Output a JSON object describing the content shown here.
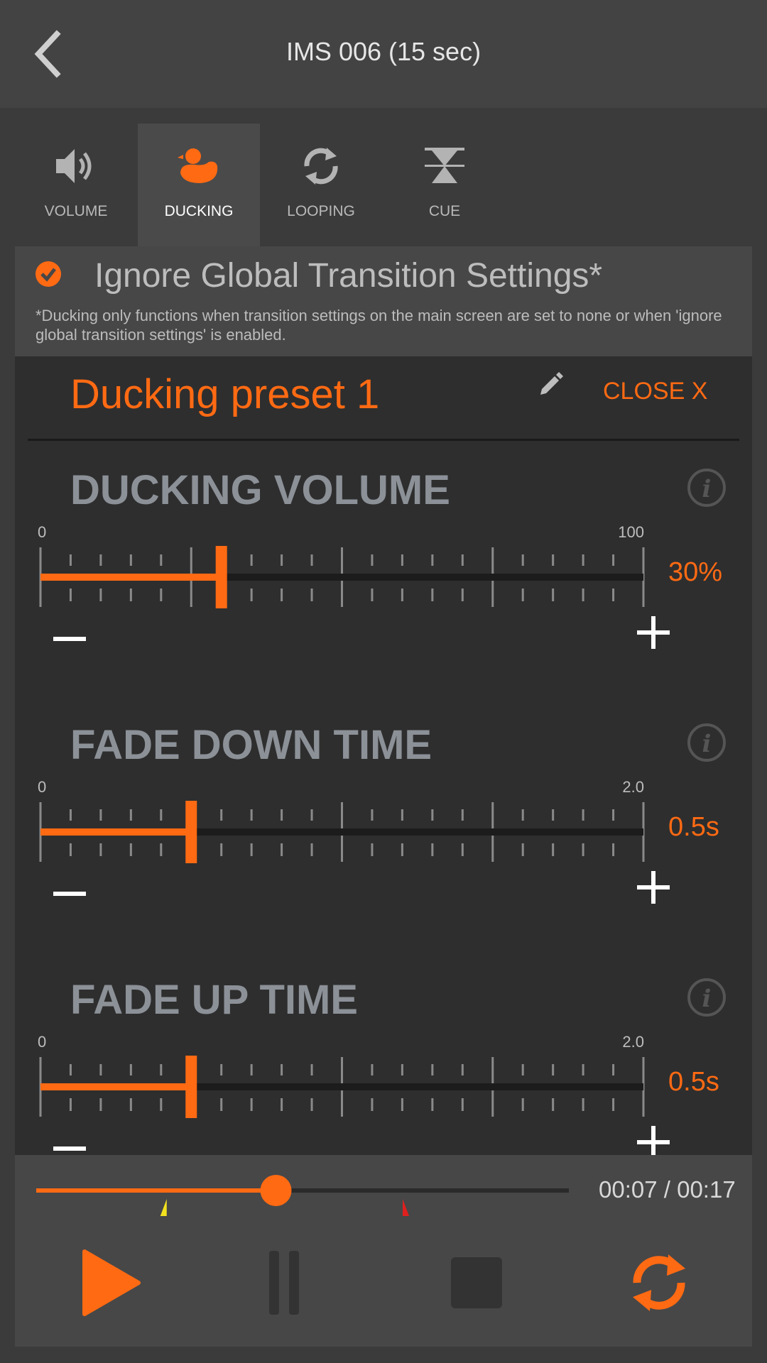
{
  "header": {
    "title": "IMS 006 (15 sec)",
    "back_icon": "chevron-left-icon"
  },
  "tabs": [
    {
      "label": "VOLUME",
      "icon": "speaker-icon",
      "active": false
    },
    {
      "label": "DUCKING",
      "icon": "duck-icon",
      "active": true
    },
    {
      "label": "LOOPING",
      "icon": "loop-icon",
      "active": false
    },
    {
      "label": "CUE",
      "icon": "cue-icon",
      "active": false
    }
  ],
  "ignore_global": {
    "checked": true,
    "title": "Ignore Global Transition Settings*",
    "note": "*Ducking only functions when transition settings on the main screen are set to none or when 'ignore global transition settings' is enabled."
  },
  "preset": {
    "name": "Ducking preset 1",
    "close_label": "CLOSE X"
  },
  "sections": [
    {
      "title": "DUCKING VOLUME",
      "min_label": "0",
      "max_label": "100",
      "min": 0,
      "max": 100,
      "value": 30,
      "value_label": "30%"
    },
    {
      "title": "FADE DOWN TIME",
      "min_label": "0",
      "max_label": "2.0",
      "min": 0,
      "max": 2.0,
      "value": 0.5,
      "value_label": "0.5s"
    },
    {
      "title": "FADE UP TIME",
      "min_label": "0",
      "max_label": "2.0",
      "min": 0,
      "max": 2.0,
      "value": 0.5,
      "value_label": "0.5s"
    }
  ],
  "player": {
    "time": "00:07 / 00:17",
    "progress": 0.45,
    "cue_in_marker": 0.245,
    "cue_out_marker": 0.688
  },
  "colors": {
    "accent": "#ff6a13",
    "cue_in": "#f3e11e",
    "cue_out": "#e0201e"
  }
}
